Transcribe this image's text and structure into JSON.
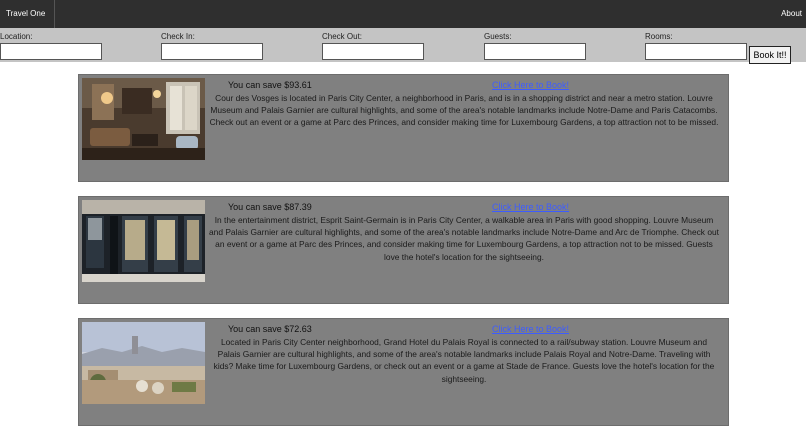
{
  "nav": {
    "brand": "Travel One",
    "about": "About"
  },
  "search": {
    "fields": [
      {
        "label": "Location:",
        "value": ""
      },
      {
        "label": "Check In:",
        "value": ""
      },
      {
        "label": "Check Out:",
        "value": ""
      },
      {
        "label": "Guests:",
        "value": ""
      },
      {
        "label": "Rooms:",
        "value": ""
      }
    ],
    "book_label": "Book It!!"
  },
  "hotels": [
    {
      "saving": "You can save $93.61",
      "link": "Click Here to Book!",
      "description": "Cour des Vosges is located in Paris City Center, a neighborhood in Paris, and is in a shopping district and near a metro station. Louvre Museum and Palais Garnier are cultural highlights, and some of the area's notable landmarks include Notre-Dame and Paris Catacombs. Check out an event or a game at Parc des Princes, and consider making time for Luxembourg Gardens, a top attraction not to be missed.",
      "image": "hotel-lounge-photo"
    },
    {
      "saving": "You can save $87.39",
      "link": "Click Here to Book!",
      "description": "In the entertainment district, Esprit Saint-Germain is in Paris City Center, a walkable area in Paris with good shopping. Louvre Museum and Palais Garnier are cultural highlights, and some of the area's notable landmarks include Notre-Dame and Arc de Triomphe. Check out an event or a game at Parc des Princes, and consider making time for Luxembourg Gardens, a top attraction not to be missed. Guests love the hotel's location for the sightseeing.",
      "image": "hotel-facade-photo"
    },
    {
      "saving": "You can save $72.63",
      "link": "Click Here to Book!",
      "description": "Located in Paris City Center neighborhood, Grand Hotel du Palais Royal is connected to a rail/subway station. Louvre Museum and Palais Garnier are cultural highlights, and some of the area's notable landmarks include Palais Royal and Notre-Dame. Traveling with kids? Make time for Luxembourg Gardens, or check out an event or a game at Stade de France. Guests love the hotel's location for the sightseeing.",
      "image": "hotel-terrace-photo"
    }
  ]
}
